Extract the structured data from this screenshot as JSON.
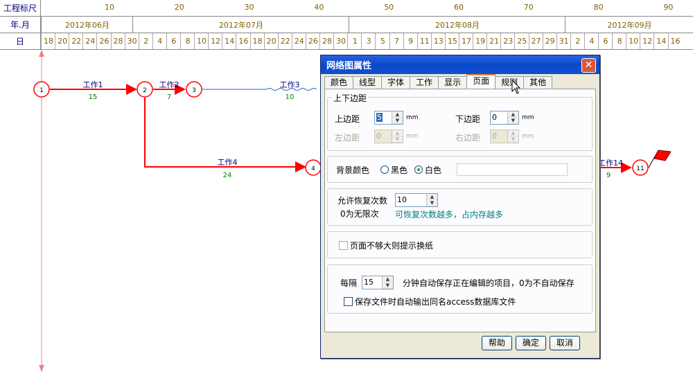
{
  "ruler": {
    "scale_label": "工程标尺",
    "month_label": "年.月",
    "day_label": "日",
    "scale_ticks": [
      "10",
      "20",
      "30",
      "40",
      "50",
      "60",
      "70",
      "80",
      "90"
    ],
    "months": [
      "2012年06月",
      "2012年07月",
      "2012年08月",
      "2012年09月"
    ],
    "days": [
      "18",
      "20",
      "22",
      "24",
      "26",
      "28",
      "30",
      "2",
      "4",
      "6",
      "8",
      "10",
      "12",
      "14",
      "16",
      "18",
      "20",
      "22",
      "24",
      "26",
      "28",
      "30",
      "1",
      "3",
      "5",
      "7",
      "9",
      "11",
      "13",
      "15",
      "17",
      "19",
      "21",
      "23",
      "25",
      "27",
      "29",
      "31",
      "2",
      "4",
      "6",
      "8",
      "10",
      "12",
      "14",
      "16"
    ]
  },
  "network": {
    "nodes": [
      "1",
      "2",
      "3",
      "4",
      "11"
    ],
    "tasks": [
      {
        "name": "工作1",
        "duration": "15"
      },
      {
        "name": "工作2",
        "duration": "7"
      },
      {
        "name": "工作3",
        "duration": "10"
      },
      {
        "name": "工作4",
        "duration": "24"
      },
      {
        "name": "工作14",
        "duration": "9"
      }
    ]
  },
  "dialog": {
    "title": "网络图属性",
    "close": "✕",
    "tabs": [
      "颜色",
      "线型",
      "字体",
      "工作",
      "显示",
      "页面",
      "规则",
      "其他"
    ],
    "active_tab": "页面",
    "margins": {
      "group_title": "上下边距",
      "top_label": "上边距",
      "top_value": "5",
      "bottom_label": "下边距",
      "bottom_value": "0",
      "left_label": "左边距",
      "left_value": "0",
      "right_label": "右边距",
      "right_value": "0",
      "unit": "mm"
    },
    "background": {
      "label": "背景颜色",
      "black": "黑色",
      "white": "白色"
    },
    "undo": {
      "label": "允许恢复次数",
      "value": "10",
      "hint": "0为无限次",
      "note": "可恢复次数越多，占内存越多"
    },
    "paper": {
      "label": "页面不够大则提示换纸"
    },
    "autosave": {
      "prefix": "每隔",
      "value": "15",
      "suffix": "分钟自动保存正在编辑的项目，0为不自动保存",
      "export_label": "保存文件时自动输出同名access数据库文件"
    },
    "buttons": {
      "help": "帮助",
      "ok": "确定",
      "cancel": "取消"
    }
  },
  "colors": {
    "accent": "#ff0000",
    "title_bar": "#0a48c8",
    "ruler_text": "#806000",
    "highlight": "#008080"
  }
}
